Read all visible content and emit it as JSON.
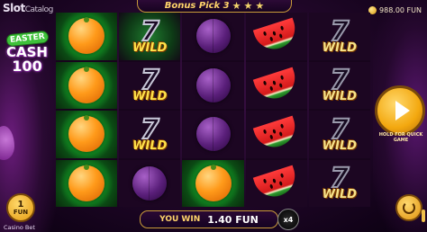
{
  "brand": {
    "name": "Slot",
    "suffix": "Catalog"
  },
  "header": {
    "bonus_label": "Bonus Pick 3",
    "stars": [
      "★",
      "★",
      "★"
    ]
  },
  "balance": {
    "value": "988.00 FUN"
  },
  "logo": {
    "line1": "EASTER",
    "line2": "CASH",
    "line3": "100"
  },
  "bet": {
    "value": "1",
    "unit": "FUN",
    "label": "Casino Bet"
  },
  "reels": [
    [
      "orange",
      "orange",
      "orange",
      "orange"
    ],
    [
      "wild",
      "wild",
      "wild",
      "plum"
    ],
    [
      "plum",
      "plum",
      "plum",
      "orange"
    ],
    [
      "watermelon",
      "watermelon",
      "watermelon",
      "watermelon"
    ],
    [
      "wild",
      "wild",
      "wild",
      "wild"
    ]
  ],
  "symbols": {
    "wild_seven": "7",
    "wild_text": "WILD"
  },
  "win": {
    "label": "YOU WIN",
    "amount": "1.40 FUN",
    "multiplier": "x4"
  },
  "spin": {
    "hold_text": "HOLD FOR QUICK GAME"
  },
  "colors": {
    "accent_gold": "#ffd46a",
    "win_glow": "#3fff5a",
    "background": "#1e0626"
  }
}
